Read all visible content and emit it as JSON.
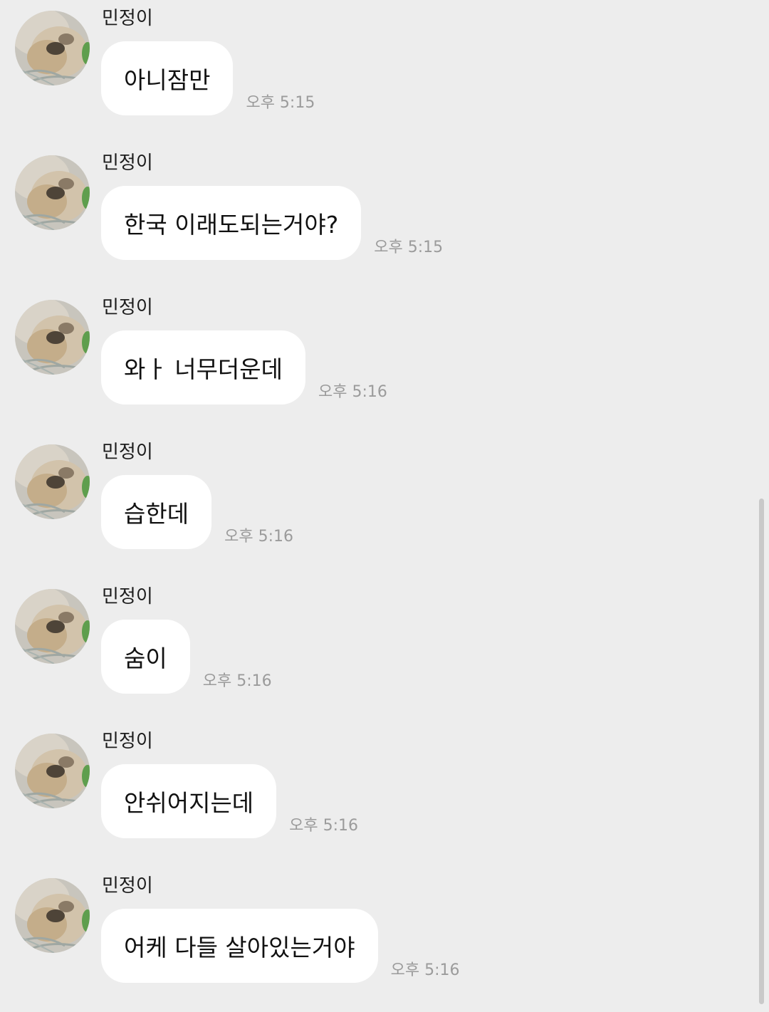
{
  "chat": {
    "messages": [
      {
        "sender": "민정이",
        "text": "아니잠만",
        "time": "오후 5:15"
      },
      {
        "sender": "민정이",
        "text": "한국 이래도되는거야?",
        "time": "오후 5:15"
      },
      {
        "sender": "민정이",
        "text": "와ㅏ 너무더운데",
        "time": "오후 5:16"
      },
      {
        "sender": "민정이",
        "text": "습한데",
        "time": "오후 5:16"
      },
      {
        "sender": "민정이",
        "text": "숨이",
        "time": "오후 5:16"
      },
      {
        "sender": "민정이",
        "text": "안쉬어지는데",
        "time": "오후 5:16"
      },
      {
        "sender": "민정이",
        "text": "어케 다들 살아있는거야",
        "time": "오후 5:16"
      }
    ]
  },
  "avatar_icon": "dog-photo-avatar",
  "colors": {
    "background": "#ededed",
    "bubble": "#ffffff",
    "timestamp": "#9b9b9b"
  }
}
